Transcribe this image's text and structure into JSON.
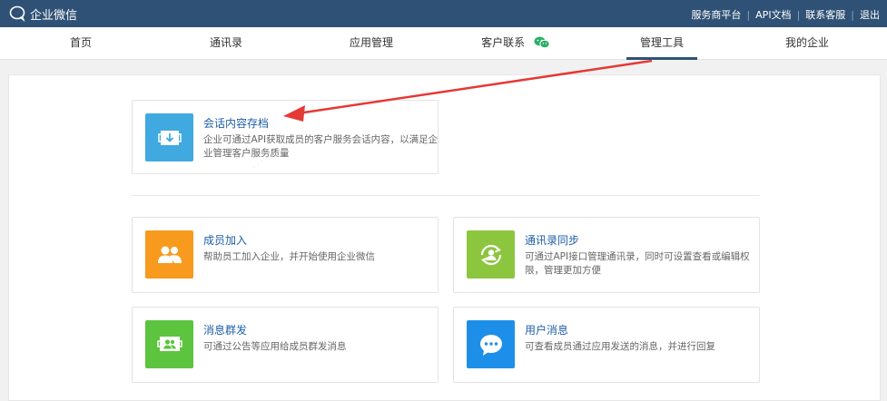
{
  "app": {
    "title": "企业微信"
  },
  "toplinks": [
    "服务商平台",
    "API文档",
    "联系客服",
    "退出"
  ],
  "nav": {
    "items": [
      {
        "label": "首页"
      },
      {
        "label": "通讯录"
      },
      {
        "label": "应用管理"
      },
      {
        "label": "客户联系"
      },
      {
        "label": "管理工具"
      },
      {
        "label": "我的企业"
      }
    ],
    "active": "管理工具"
  },
  "tools": {
    "archive": {
      "title": "会话内容存档",
      "desc": "企业可通过API获取成员的客户服务会话内容，以满足企业管理客户服务质量",
      "icon": "archive-download-icon",
      "color": "#3fa9e0"
    },
    "join": {
      "title": "成员加入",
      "desc": "帮助员工加入企业，并开始使用企业微信",
      "icon": "members-icon",
      "color": "#f79a1e"
    },
    "sync": {
      "title": "通讯录同步",
      "desc": "可通过API接口管理通讯录，同时可设置查看或编辑权限，管理更加方便",
      "icon": "sync-contacts-icon",
      "color": "#8cc63f"
    },
    "broadcast": {
      "title": "消息群发",
      "desc": "可通过公告等应用给成员群发消息",
      "icon": "broadcast-message-icon",
      "color": "#5cc43f"
    },
    "usermsg": {
      "title": "用户消息",
      "desc": "可查看成员通过应用发送的消息，并进行回复",
      "icon": "chat-bubble-icon",
      "color": "#1e8fe8"
    }
  },
  "colors": {
    "topbar": "#2f5175",
    "link": "#1f5fa8",
    "annotation_arrow": "#e53935"
  }
}
